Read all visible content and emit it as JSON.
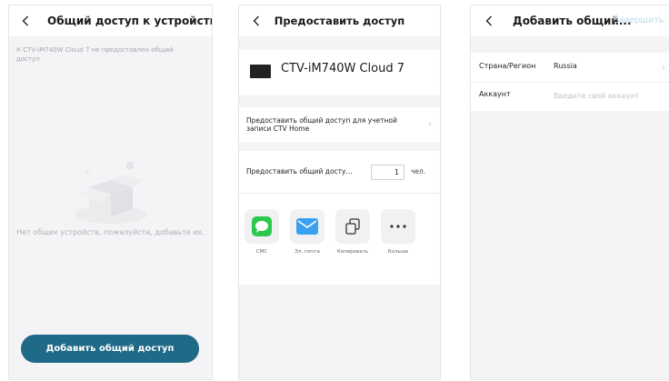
{
  "screens": {
    "no_devices": {
      "title": "Общий доступ к устройствам",
      "notice": "К CTV-iM740W Cloud 7 не предоставлен общий доступ",
      "empty_text": "Нет общих устройств, пожалуйста, добавьте их.",
      "add_button": "Добавить общий доступ"
    },
    "grant_access": {
      "title": "Предоставить доступ",
      "device_name": "CTV-iM740W Cloud 7",
      "share_account_label": "Предоставить общий доступ для учетной записи CTV Home",
      "share_count_label": "Предоставить общий досту...",
      "share_count_value": "1",
      "share_count_unit": "чел.",
      "share_options": [
        {
          "label": "СМС",
          "icon": "sms-icon",
          "color": "#2dc84d"
        },
        {
          "label": "Эл. почта",
          "icon": "email-icon",
          "color": "#3aa0f0"
        },
        {
          "label": "Копировать",
          "icon": "copy-icon",
          "color": "#333333"
        },
        {
          "label": "Больше",
          "icon": "more-icon",
          "color": "#333333"
        }
      ]
    },
    "add_share": {
      "title": "Добавить общий...",
      "finish_label": "Завершить",
      "country_label": "Страна/Регион",
      "country_value": "Russia",
      "account_label": "Аккаунт",
      "account_placeholder": "Введите свой аккаунт"
    }
  },
  "colors": {
    "primary_button": "#1f6a86",
    "finish_disabled": "#b9d9ea",
    "screen_background": "#f4f4f6"
  }
}
